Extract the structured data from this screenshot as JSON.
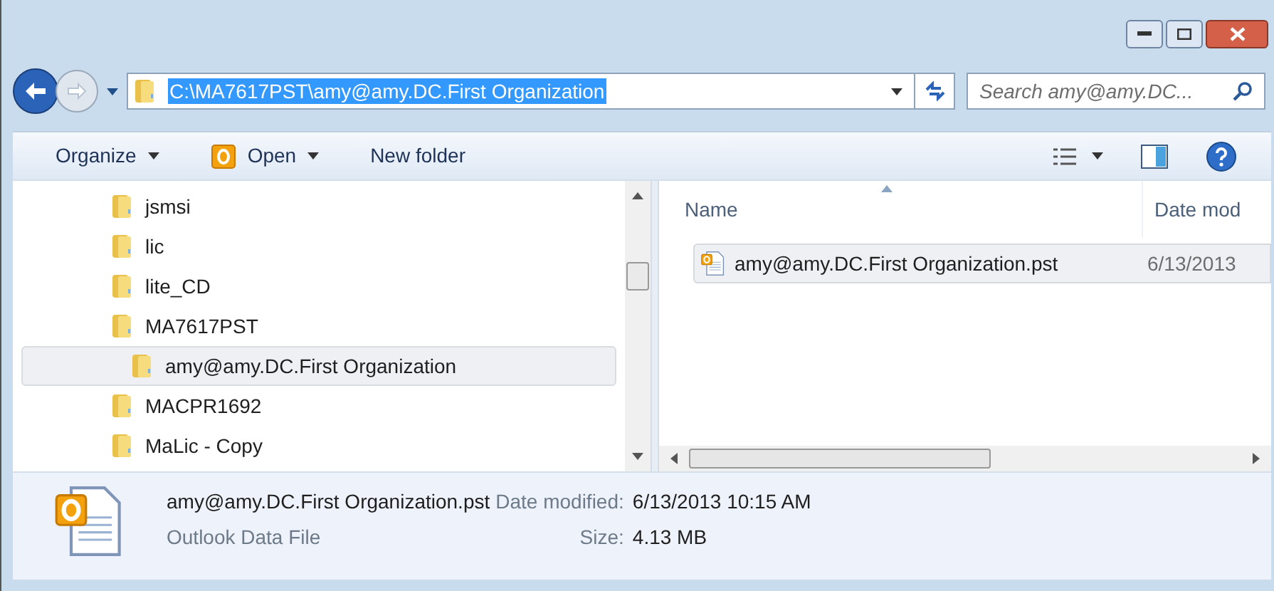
{
  "address_bar": {
    "path": "C:\\MA7617PST\\amy@amy.DC.First Organization"
  },
  "search": {
    "placeholder": "Search amy@amy.DC..."
  },
  "toolbar": {
    "buttons": [
      {
        "label": "Organize",
        "kind": "menu"
      },
      {
        "label": "Open",
        "kind": "open"
      },
      {
        "label": "New folder",
        "kind": "plain"
      }
    ]
  },
  "tree": {
    "items": [
      {
        "label": "jsmsi",
        "selected": false
      },
      {
        "label": "lic",
        "selected": false
      },
      {
        "label": "lite_CD",
        "selected": false
      },
      {
        "label": "MA7617PST",
        "selected": false,
        "children": [
          {
            "label": "amy@amy.DC.First Organization",
            "selected": true
          }
        ]
      },
      {
        "label": "MACPR1692",
        "selected": false
      },
      {
        "label": "MaLic - Copy",
        "selected": false
      }
    ]
  },
  "file_list": {
    "columns": [
      "Name",
      "Date mod"
    ],
    "rows": [
      {
        "name": "amy@amy.DC.First Organization.pst",
        "date": "6/13/2013",
        "selected": true
      }
    ]
  },
  "details": {
    "file_name": "amy@amy.DC.First Organization.pst",
    "file_type": "Outlook Data File",
    "fields": [
      {
        "label": "Date modified:",
        "value": "6/13/2013 10:15 AM"
      },
      {
        "label": "Size:",
        "value": "4.13 MB"
      }
    ]
  }
}
